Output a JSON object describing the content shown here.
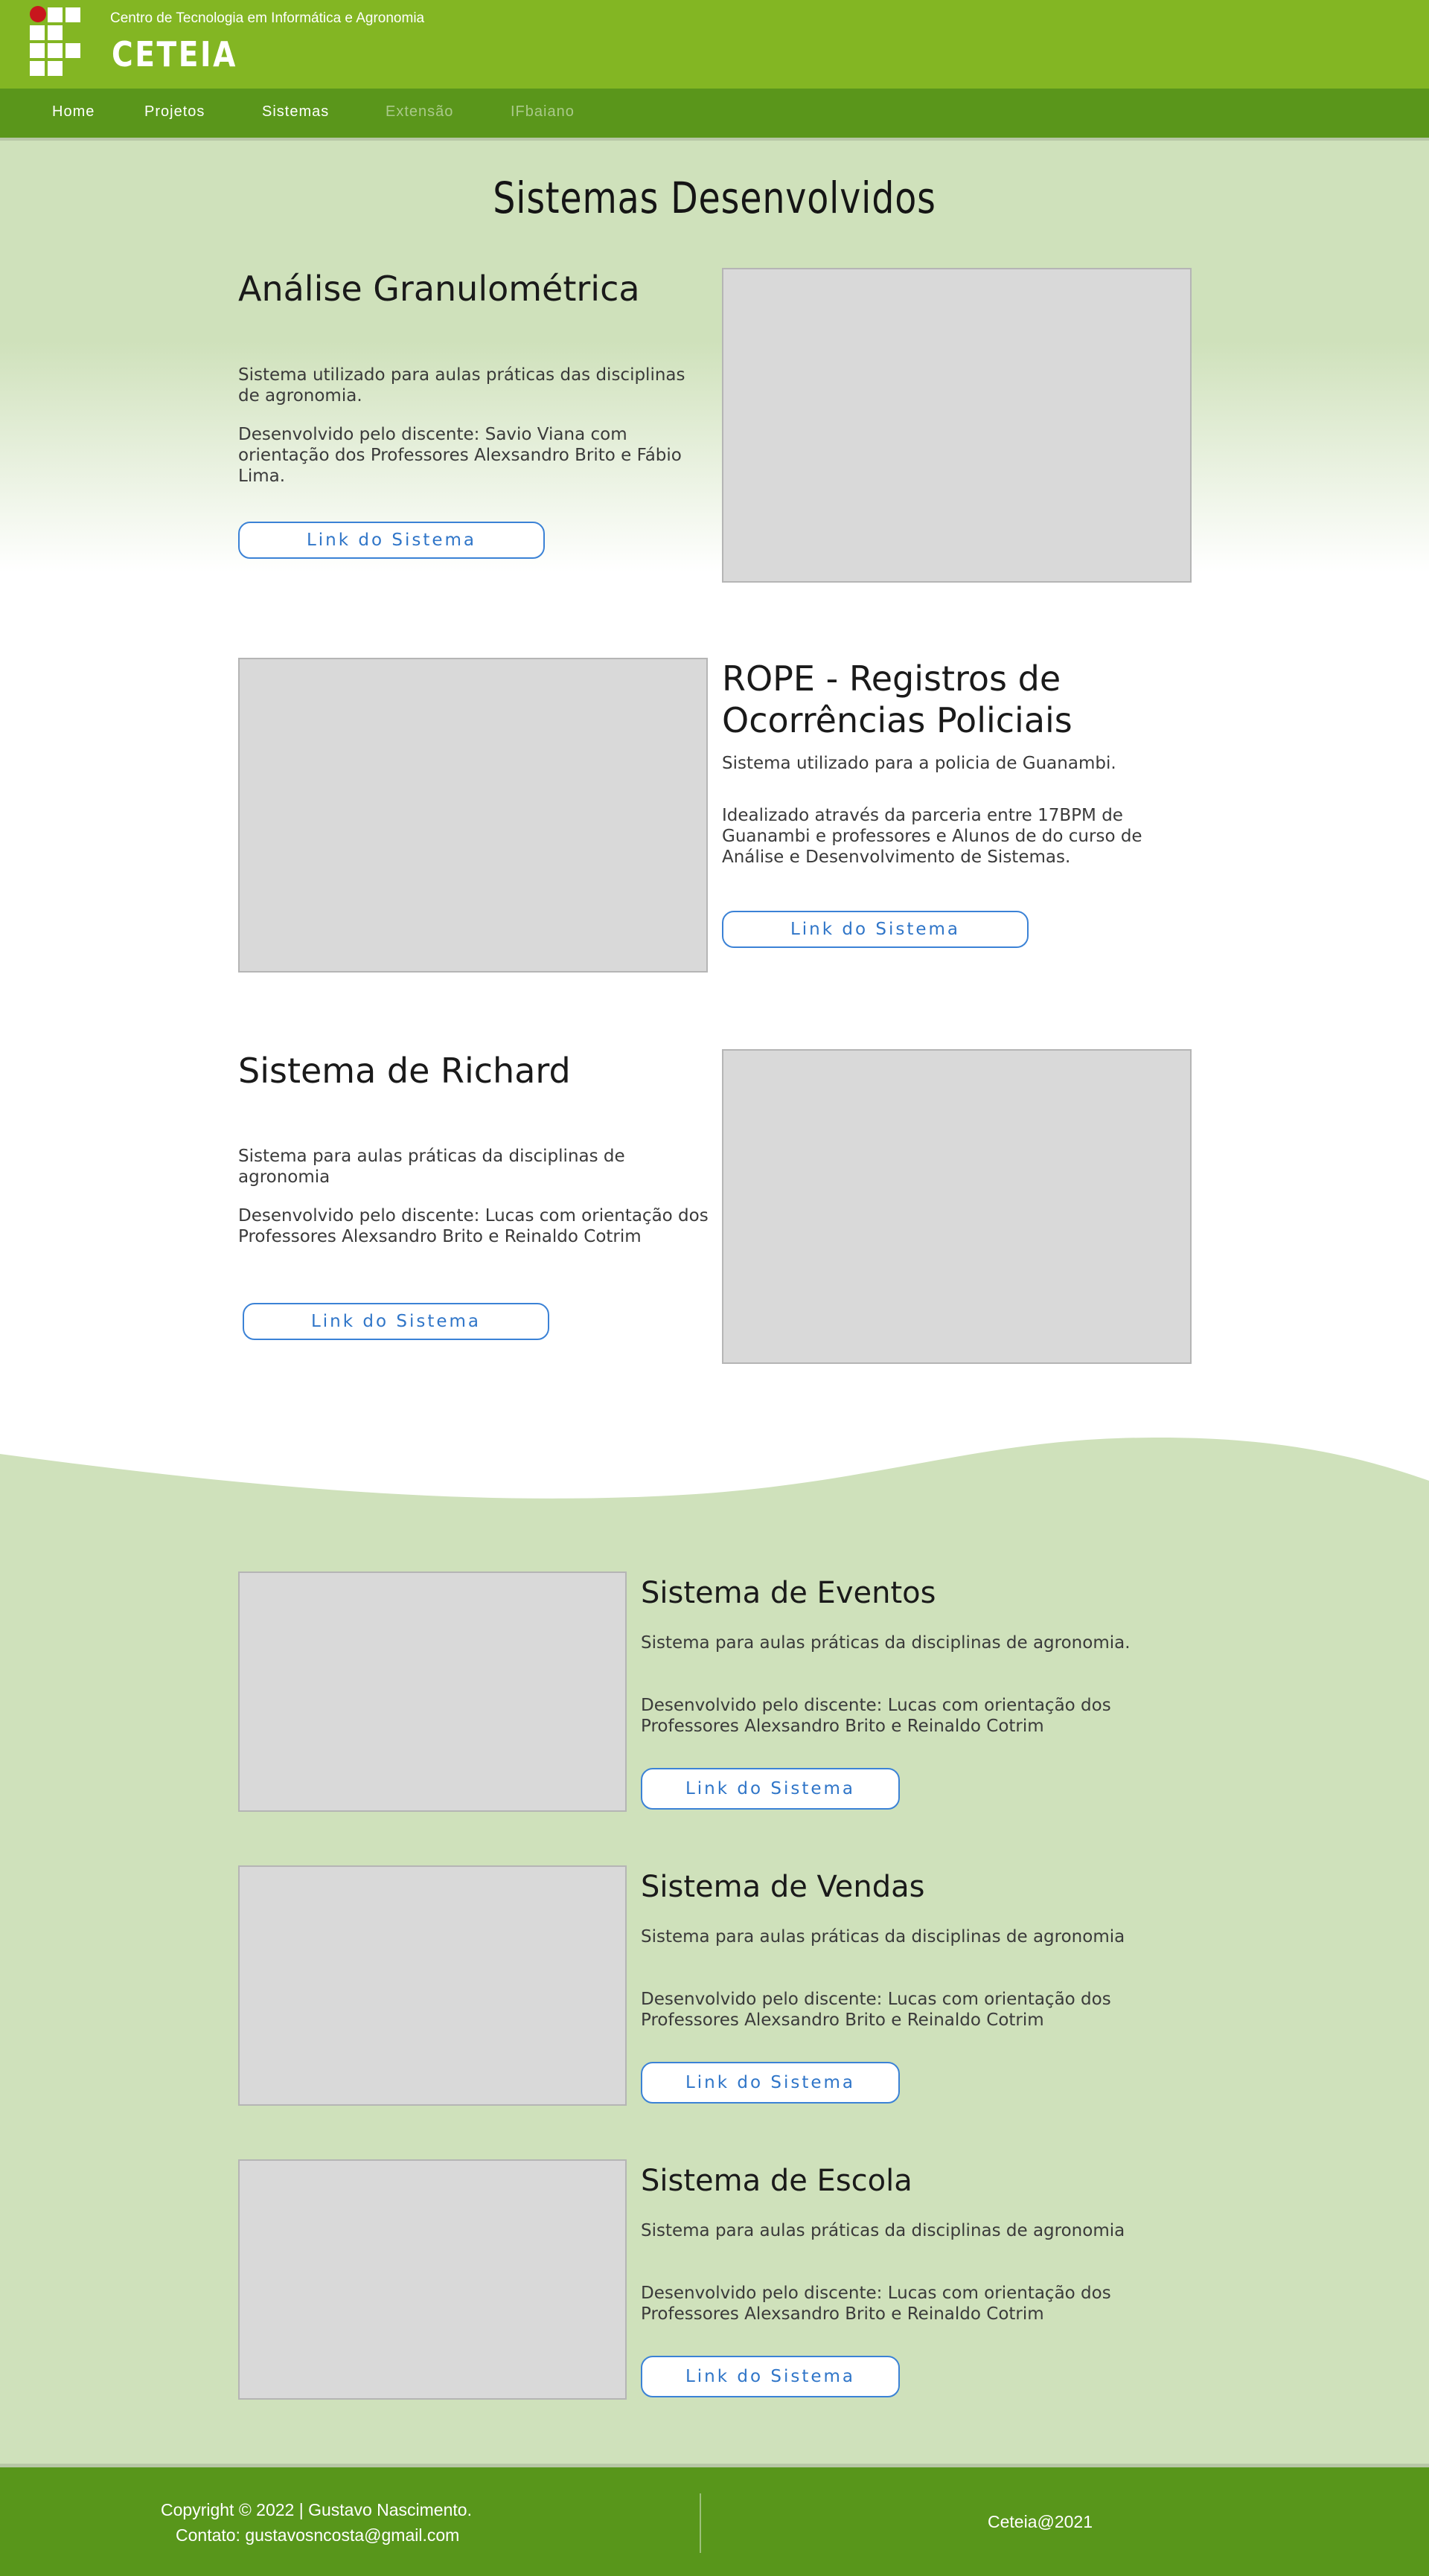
{
  "header": {
    "subtitle": "Centro de Tecnologia em Informática e Agronomia",
    "brand": "CETEIA",
    "logo_icon": "ifbaiano-logo-icon"
  },
  "nav": {
    "items": [
      {
        "label": "Home"
      },
      {
        "label": "Projetos"
      },
      {
        "label": "Sistemas"
      },
      {
        "label": "Extensão"
      },
      {
        "label": "IFbaiano"
      }
    ]
  },
  "page": {
    "title": "Sistemas Desenvolvidos"
  },
  "systems": [
    {
      "title": "Análise Granulométrica",
      "desc1": "Sistema utilizado para aulas práticas das disciplinas de agronomia.",
      "desc2": "Desenvolvido pelo discente: Savio Viana com orientação dos Professores Alexsandro Brito e Fábio Lima.",
      "link_label": "Link do Sistema"
    },
    {
      "title": "ROPE - Registros de Ocorrências Policiais",
      "desc1": "Sistema utilizado para a policia de Guanambi.",
      "desc2": "Idealizado através da parceria entre 17BPM de Guanambi e professores e Alunos de do curso de Análise e Desenvolvimento de Sistemas.",
      "link_label": "Link do Sistema"
    },
    {
      "title": "Sistema de Richard",
      "desc1": "Sistema para aulas práticas da disciplinas de agronomia",
      "desc2": "Desenvolvido pelo discente: Lucas com orientação dos Professores Alexsandro Brito e Reinaldo Cotrim",
      "link_label": "Link do Sistema"
    },
    {
      "title": "Sistema de Eventos",
      "desc1": "Sistema para aulas práticas da disciplinas de agronomia.",
      "desc2": "Desenvolvido pelo discente: Lucas com orientação dos Professores Alexsandro Brito e Reinaldo Cotrim",
      "link_label": "Link do Sistema"
    },
    {
      "title": "Sistema de Vendas",
      "desc1": "Sistema para aulas práticas da disciplinas de agronomia",
      "desc2": "Desenvolvido pelo discente: Lucas com orientação dos Professores Alexsandro Brito e Reinaldo Cotrim",
      "link_label": "Link do Sistema"
    },
    {
      "title": "Sistema de Escola",
      "desc1": "Sistema para aulas práticas da disciplinas de agronomia",
      "desc2": "Desenvolvido pelo discente: Lucas com orientação dos Professores Alexsandro Brito e Reinaldo Cotrim",
      "link_label": "Link do Sistema"
    }
  ],
  "footer": {
    "copyright": "Copyright © 2022 | Gustavo Nascimento.",
    "contact": "Contato: gustavosncosta@gmail.com",
    "right_text": "Ceteia@2021"
  },
  "colors": {
    "header_green": "#83b623",
    "nav_green": "#5a961b",
    "section_green": "#cfe1bb",
    "link_blue": "#2f75c8",
    "logo_red": "#c8161d"
  }
}
